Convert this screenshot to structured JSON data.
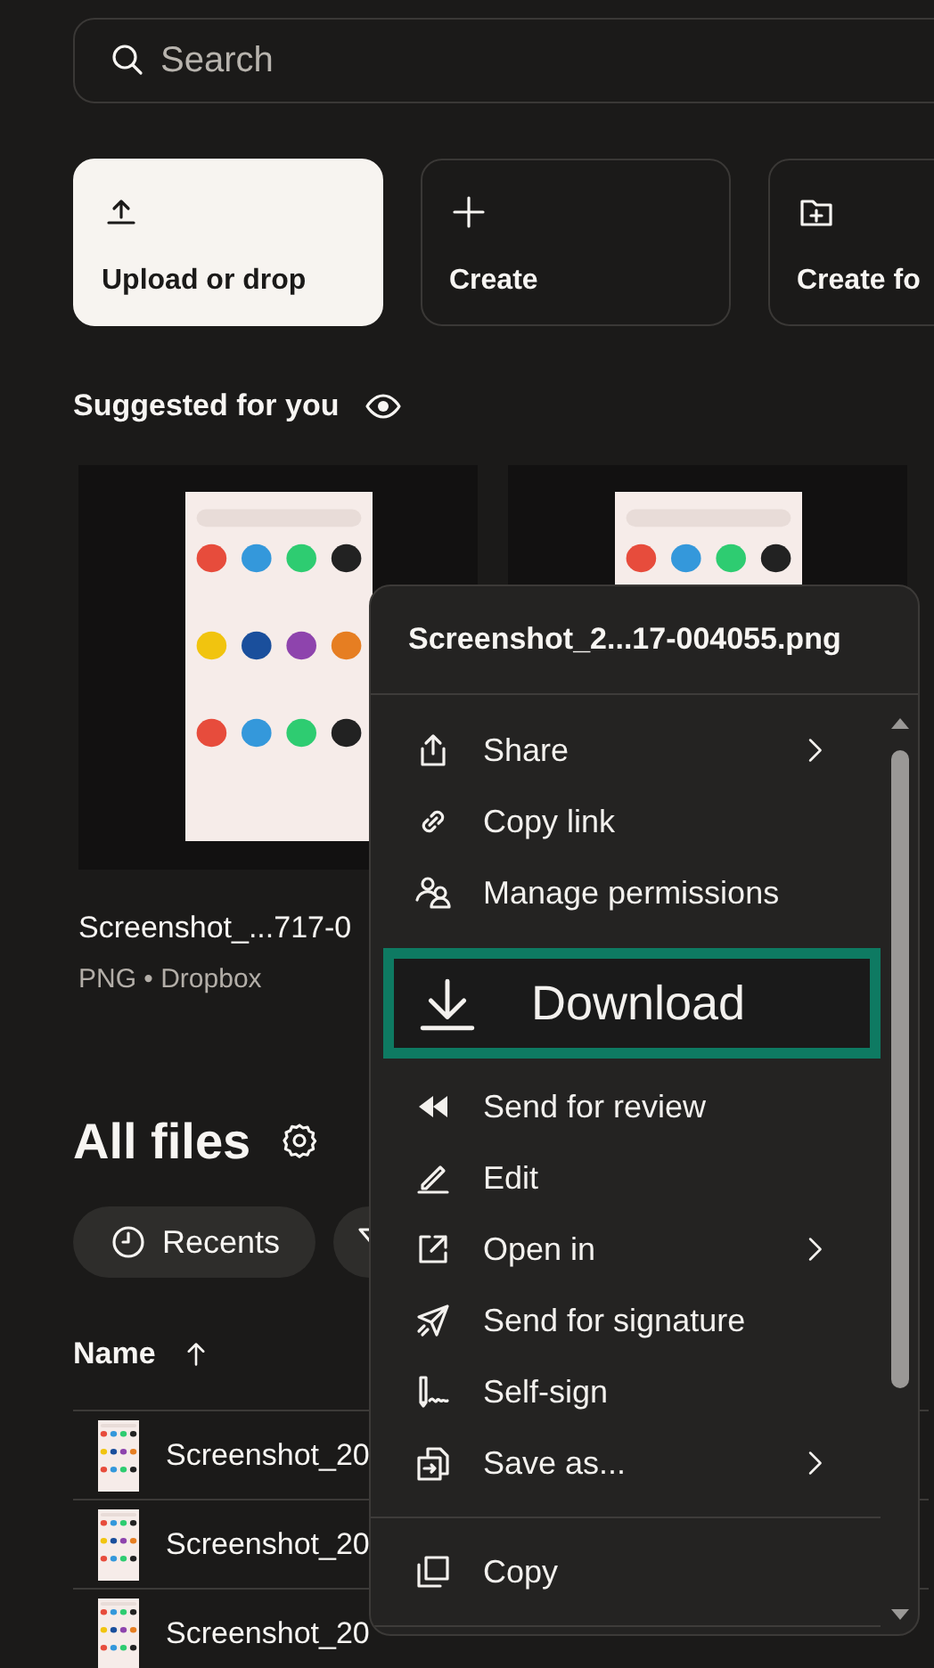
{
  "search": {
    "placeholder": "Search"
  },
  "actions": [
    {
      "label": "Upload or drop",
      "primary": true
    },
    {
      "label": "Create",
      "primary": false
    },
    {
      "label": "Create fo",
      "primary": false
    }
  ],
  "suggested": {
    "title": "Suggested for you",
    "cards": [
      {
        "kind": "picture",
        "name": "Screenshot_...717-0",
        "meta": "PNG • Dropbox"
      },
      {
        "kind": "picture"
      }
    ]
  },
  "all_files": {
    "title": "All files",
    "filters": [
      {
        "kind": "labeled",
        "label": "Recents"
      },
      {
        "kind": "icon-only"
      }
    ],
    "table": {
      "columns": [
        {
          "label": "Name",
          "sorted": true
        }
      ],
      "rows": [
        {
          "name": "Screenshot_20"
        },
        {
          "name": "Screenshot_20"
        },
        {
          "name": "Screenshot_20"
        }
      ]
    }
  },
  "context_menu": {
    "title": "Screenshot_2...17-004055.png",
    "groups": [
      [
        {
          "label": "Share",
          "submenu": true,
          "selected": false
        },
        {
          "label": "Copy link",
          "submenu": false,
          "selected": false
        },
        {
          "label": "Manage permissions",
          "submenu": false,
          "selected": false
        },
        {
          "label": "Download",
          "submenu": false,
          "selected": true
        },
        {
          "label": "Send for review",
          "submenu": false,
          "selected": false
        },
        {
          "label": "Edit",
          "submenu": false,
          "selected": false
        },
        {
          "label": "Open in",
          "submenu": true,
          "selected": false
        },
        {
          "label": "Send for signature",
          "submenu": false,
          "selected": false
        },
        {
          "label": "Self-sign",
          "submenu": false,
          "selected": false
        },
        {
          "label": "Save as...",
          "submenu": true,
          "selected": false
        }
      ],
      [
        {
          "label": "Copy",
          "submenu": false,
          "selected": false
        }
      ]
    ]
  }
}
